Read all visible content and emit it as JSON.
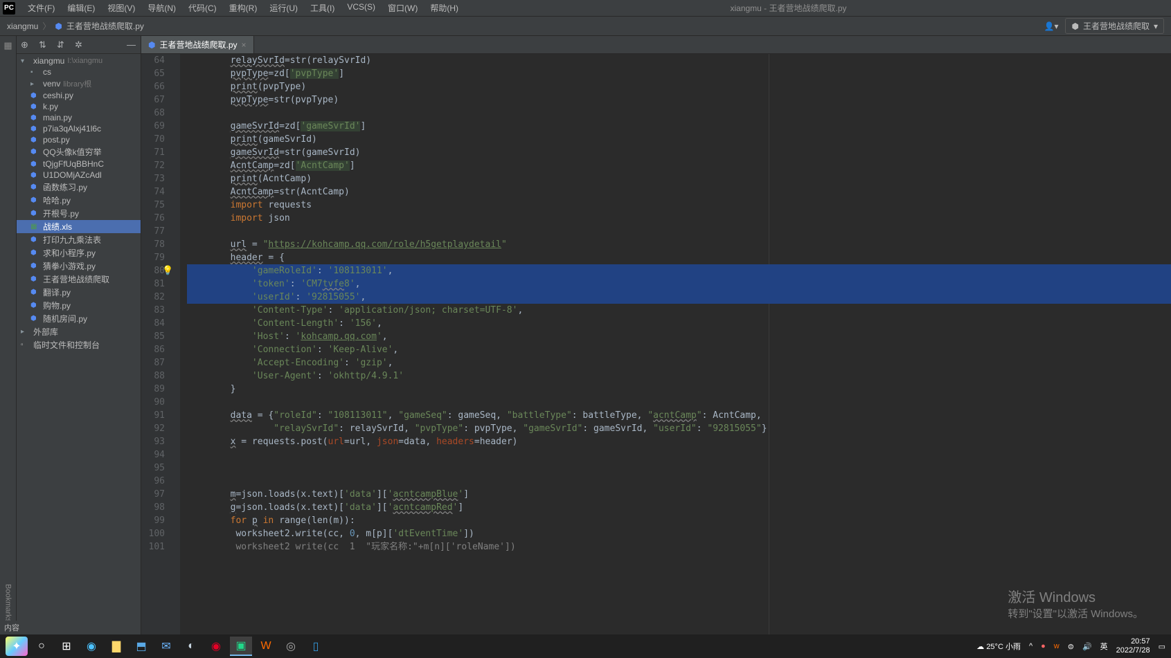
{
  "app": {
    "title": "xiangmu - 王者营地战绩爬取.py",
    "icon": "PC"
  },
  "menu": [
    "文件(F)",
    "编辑(E)",
    "视图(V)",
    "导航(N)",
    "代码(C)",
    "重构(R)",
    "运行(U)",
    "工具(I)",
    "VCS(S)",
    "窗口(W)",
    "帮助(H)"
  ],
  "breadcrumb": {
    "project": "xiangmu",
    "file": "王者营地战绩爬取.py"
  },
  "run_config": "王者营地战绩爬取",
  "project_tree": [
    {
      "indent": 0,
      "icon": "▾",
      "type": "folder",
      "name": "xiangmu",
      "dim": "I:\\xiangmu"
    },
    {
      "indent": 1,
      "icon": "",
      "type": "folder",
      "name": "cs"
    },
    {
      "indent": 1,
      "icon": "▸",
      "type": "folder",
      "name": "venv",
      "dim": "library根"
    },
    {
      "indent": 1,
      "icon": "",
      "type": "py",
      "name": "ceshi.py"
    },
    {
      "indent": 1,
      "icon": "",
      "type": "py",
      "name": "k.py"
    },
    {
      "indent": 1,
      "icon": "",
      "type": "py",
      "name": "main.py"
    },
    {
      "indent": 1,
      "icon": "",
      "type": "py",
      "name": "p7ia3qAlxj41l6c"
    },
    {
      "indent": 1,
      "icon": "",
      "type": "py",
      "name": "post.py"
    },
    {
      "indent": 1,
      "icon": "",
      "type": "py",
      "name": "QQ头像k值穷举"
    },
    {
      "indent": 1,
      "icon": "",
      "type": "py",
      "name": "tQjgFfUqBBHnC"
    },
    {
      "indent": 1,
      "icon": "",
      "type": "py",
      "name": "U1DOMjAZcAdl"
    },
    {
      "indent": 1,
      "icon": "",
      "type": "py",
      "name": "函数练习.py"
    },
    {
      "indent": 1,
      "icon": "",
      "type": "py",
      "name": "哈哈.py"
    },
    {
      "indent": 1,
      "icon": "",
      "type": "py",
      "name": "开根号.py"
    },
    {
      "indent": 1,
      "icon": "",
      "type": "xls",
      "name": "战绩.xls",
      "selected": true
    },
    {
      "indent": 1,
      "icon": "",
      "type": "py",
      "name": "打印九九乘法表"
    },
    {
      "indent": 1,
      "icon": "",
      "type": "py",
      "name": "求和小程序.py"
    },
    {
      "indent": 1,
      "icon": "",
      "type": "py",
      "name": "猜拳小游戏.py"
    },
    {
      "indent": 1,
      "icon": "",
      "type": "py",
      "name": "王者营地战绩爬取"
    },
    {
      "indent": 1,
      "icon": "",
      "type": "py",
      "name": "翻译.py"
    },
    {
      "indent": 1,
      "icon": "",
      "type": "py",
      "name": "购物.py"
    },
    {
      "indent": 1,
      "icon": "",
      "type": "py",
      "name": "随机房间.py"
    },
    {
      "indent": 0,
      "icon": "▸",
      "type": "lib",
      "name": "外部库"
    },
    {
      "indent": 0,
      "icon": "",
      "type": "scratch",
      "name": "临时文件和控制台"
    }
  ],
  "tab": "王者营地战绩爬取.py",
  "line_start": 64,
  "activate": {
    "big": "激活 Windows",
    "small": "转到\"设置\"以激活 Windows。"
  },
  "status_left": "内容",
  "tray": {
    "weather": "25°C 小雨",
    "ime": "英",
    "time": "20:57",
    "date": "2022/7/28"
  },
  "left_rail_top": "项目",
  "left_rail_bottom": "Bookmarks"
}
